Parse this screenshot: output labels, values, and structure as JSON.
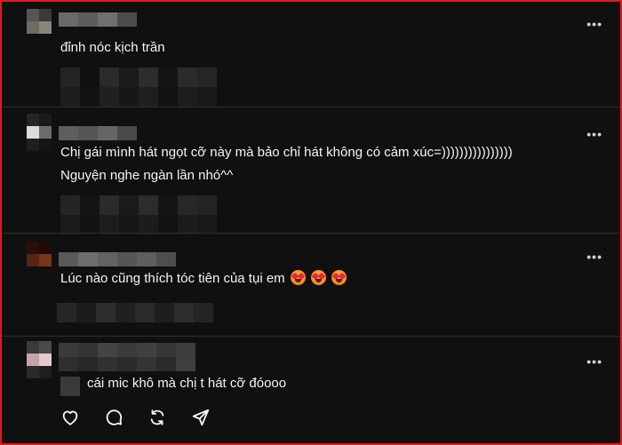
{
  "comments": [
    {
      "text": "đỉnh nóc kịch trần",
      "more_label": "•••"
    },
    {
      "text_line1": "Chị gái mình hát ngọt cỡ này mà bảo chỉ hát không có cảm xúc=))))))))))))))))",
      "text_line2": "Nguyện nghe ngàn lần nhó^^",
      "more_label": "•••"
    },
    {
      "text": "Lúc nào cũng thích tóc tiên của tụi em",
      "emojis": [
        "smiling-face-with-heart-eyes",
        "smiling-face-with-heart-eyes",
        "smiling-face-with-heart-eyes"
      ],
      "more_label": "•••"
    },
    {
      "text": "cái mic khô mà chị t hát cỡ đóooo",
      "more_label": "•••"
    }
  ],
  "actions": [
    "heart-icon",
    "comment-icon",
    "repost-icon",
    "share-icon"
  ],
  "colors": {
    "background": "#101010",
    "text": "#f3f5f7",
    "frame": "#e0191f",
    "divider": "#2e2e2e"
  }
}
